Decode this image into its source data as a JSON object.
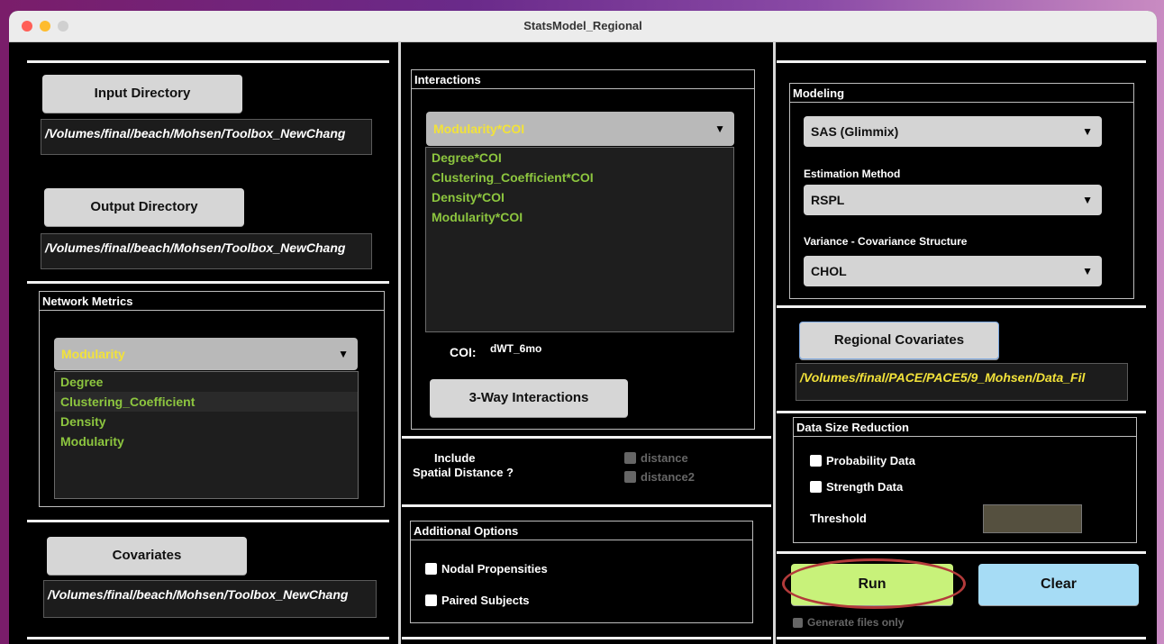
{
  "window": {
    "title": "StatsModel_Regional"
  },
  "left": {
    "input_directory": {
      "label": "Input Directory",
      "path": "/Volumes/final/beach/Mohsen/Toolbox_NewChang"
    },
    "output_directory": {
      "label": "Output Directory",
      "path": "/Volumes/final/beach/Mohsen/Toolbox_NewChang"
    },
    "network_metrics": {
      "title": "Network Metrics",
      "selected": "Modularity",
      "items": [
        "Degree",
        "Clustering_Coefficient",
        "Density",
        "Modularity"
      ]
    },
    "covariates": {
      "label": "Covariates",
      "path": "/Volumes/final/beach/Mohsen/Toolbox_NewChang"
    }
  },
  "middle": {
    "interactions": {
      "title": "Interactions",
      "selected": "Modularity*COI",
      "items": [
        "Degree*COI",
        "Clustering_Coefficient*COI",
        "Density*COI",
        "Modularity*COI"
      ],
      "coi_label": "COI:",
      "coi_value": "dWT_6mo",
      "three_way_label": "3-Way Interactions"
    },
    "spatial": {
      "label_line1": "Include",
      "label_line2": "Spatial Distance ?",
      "options": [
        "distance",
        "distance2"
      ]
    },
    "additional": {
      "title": "Additional Options",
      "options": [
        "Nodal Propensities",
        "Paired Subjects"
      ]
    }
  },
  "right": {
    "modeling": {
      "title": "Modeling",
      "software": "SAS (Glimmix)",
      "estimation_label": "Estimation Method",
      "estimation": "RSPL",
      "variance_label": "Variance - Covariance Structure",
      "variance": "CHOL"
    },
    "regional_covariates": {
      "label": "Regional Covariates",
      "path": "/Volumes/final/PACE/PACE5/9_Mohsen/Data_Fil"
    },
    "data_size": {
      "title": "Data Size Reduction",
      "options": [
        "Probability Data",
        "Strength Data"
      ],
      "threshold_label": "Threshold"
    },
    "run_label": "Run",
    "clear_label": "Clear",
    "generate_label": "Generate files only"
  },
  "colors": {
    "run": "#c8f27a",
    "clear": "#a6dcf5",
    "list_text": "#8dc63f",
    "yellow_text": "#f2e23a",
    "highlight_ring": "#b23a3a"
  }
}
